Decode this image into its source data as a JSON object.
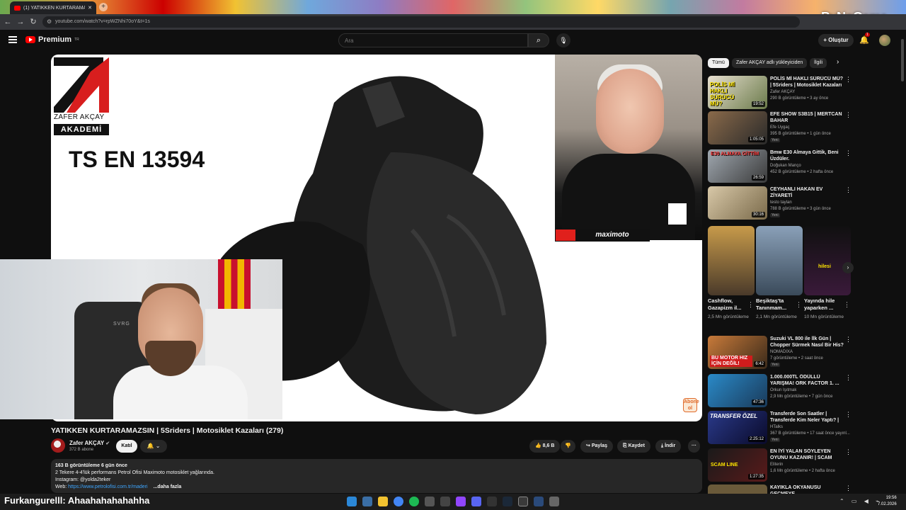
{
  "browser": {
    "tab_title": "(1) YATIKKEN KURTARAMAZSIN...",
    "tab_close": "✕",
    "new_tab": "+",
    "url": "youtube.com/watch?v=rpWZNhi70oY&t=1s",
    "watermark": "ByNoGame"
  },
  "header": {
    "logo_text": "Premium",
    "logo_region": "TR",
    "search_placeholder": "Ara",
    "create_label": "+ Oluştur",
    "notification_count": "1"
  },
  "video": {
    "overlay_name": "ZAFER AKÇAY",
    "overlay_akademi": "AKADEMİ",
    "standard": "TS EN 13594",
    "maximoto": "maximoto",
    "abone_badge": "Abone ol",
    "title": "YATIKKEN KURTARAMAZSIN | 5Sriders | Motosiklet Kazaları (279)",
    "channel": "Zafer AKÇAY",
    "verified": "✔",
    "subscribers": "372 B abone",
    "join": "Katıl",
    "likes": "8,6 B",
    "share": "Paylaş",
    "save": "Kaydet",
    "download": "İndir",
    "more": "···"
  },
  "description": {
    "stats": "163 B görüntüleme  6 gün önce",
    "line1": "2 Tekere 4-4'lük performans Petrol Ofisi Maximoto motosiklet yağlarında.",
    "line2": "Instagram: @yolda2teker",
    "web_label": "Web: ",
    "web_link": "https://www.petrolofisi.com.tr/maderi",
    "more": "...daha fazla"
  },
  "chips": [
    "Tümü",
    "Zafer AKÇAY adlı yükleyiciden",
    "İlgili"
  ],
  "recommendations": [
    {
      "title": "POLİS Mİ HAKLI SÜRÜCÜ MÜ? | 5Sriders | Motosiklet Kazaları ...",
      "channel": "Zafer AKÇAY",
      "meta": "290 B görüntüleme • 3 ay önce",
      "duration": "19:52",
      "badge": "",
      "thumb_text": "POLİS Mİ HAKLI SÜRÜCÜ MÜ?"
    },
    {
      "title": "EFE SHOW S3B15 | MERTCAN BAHAR",
      "channel": "Efe Uygaç",
      "meta": "395 B görüntüleme • 1 gün önce",
      "duration": "1:05:05",
      "badge": "Yeni",
      "thumb_text": ""
    },
    {
      "title": "Bmw E30 Almaya Gittik, Beni Üzdüler.",
      "channel": "Doğukan Manço",
      "meta": "452 B görüntüleme • 2 hafta önce",
      "duration": "26:59",
      "badge": "",
      "thumb_text": "E30 ALMAYA GİTTİM"
    },
    {
      "title": "CEYHANLI HAKAN EV ZİYARETİ",
      "channel": "testo taylan",
      "meta": "788 B görüntüleme • 3 gün önce",
      "duration": "30:16",
      "badge": "Yeni",
      "thumb_text": ""
    },
    {
      "title": "Suzuki VL 800 ile İlk Gün | Chopper Sürmek Nasıl Bir His?",
      "channel": "NOMADIXA",
      "meta": "7 görüntüleme • 2 saat önce",
      "duration": "6:42",
      "badge": "Yeni",
      "thumb_text": "BU MOTOR HIZ İÇİN DEĞİL!"
    },
    {
      "title": "1.000.000TL ÖDÜLLÜ YARIŞMA! ORK FACTOR 1. ...",
      "channel": "Orkun Işıtmak",
      "meta": "2,9 Mn görüntüleme • 7 gün önce",
      "duration": "47:36",
      "badge": "",
      "thumb_text": ""
    },
    {
      "title": "Transferde Son Saatler | Transferde Kim Neler Yaptı? | ...",
      "channel": "HTalks",
      "meta": "367 B görüntüleme • 17 saat önce yayınl...",
      "duration": "2:25:12",
      "badge": "Yeni",
      "thumb_text": "TRANSFER ÖZEL"
    },
    {
      "title": "EN İYİ YALAN SÖYLEYEN OYUNU KAZANIR! | SCAM LIN...",
      "channel": "Eliterin",
      "meta": "1,6 Mn görüntüleme • 2 hafta önce",
      "duration": "1:27:35",
      "badge": "",
      "thumb_text": "SCAM LINE"
    },
    {
      "title": "KAYIKLA OKYANUSU GEÇMEYE",
      "channel": "",
      "meta": "",
      "duration": "",
      "badge": "",
      "thumb_text": ""
    }
  ],
  "shorts": [
    {
      "title": "Cashflow, Gazapizm il...",
      "meta": "2,5 Mn görüntüleme",
      "thumb_text": ""
    },
    {
      "title": "Beşiktaş'ta Tanınmam...",
      "meta": "2,1 Mn görüntüleme",
      "thumb_text": ""
    },
    {
      "title": "Yayında hile yaparken ...",
      "meta": "10 Mn görüntüleme",
      "thumb_text": "hilesi"
    }
  ],
  "chat": {
    "user": "Furkangurelll",
    "message": ": Ahaahahahahahha"
  },
  "clock": {
    "time": "19:56",
    "date": "7.02.2026"
  },
  "colors": {
    "accent": "#ff0000",
    "link": "#3ea6ff",
    "background": "#0f0f0f"
  }
}
